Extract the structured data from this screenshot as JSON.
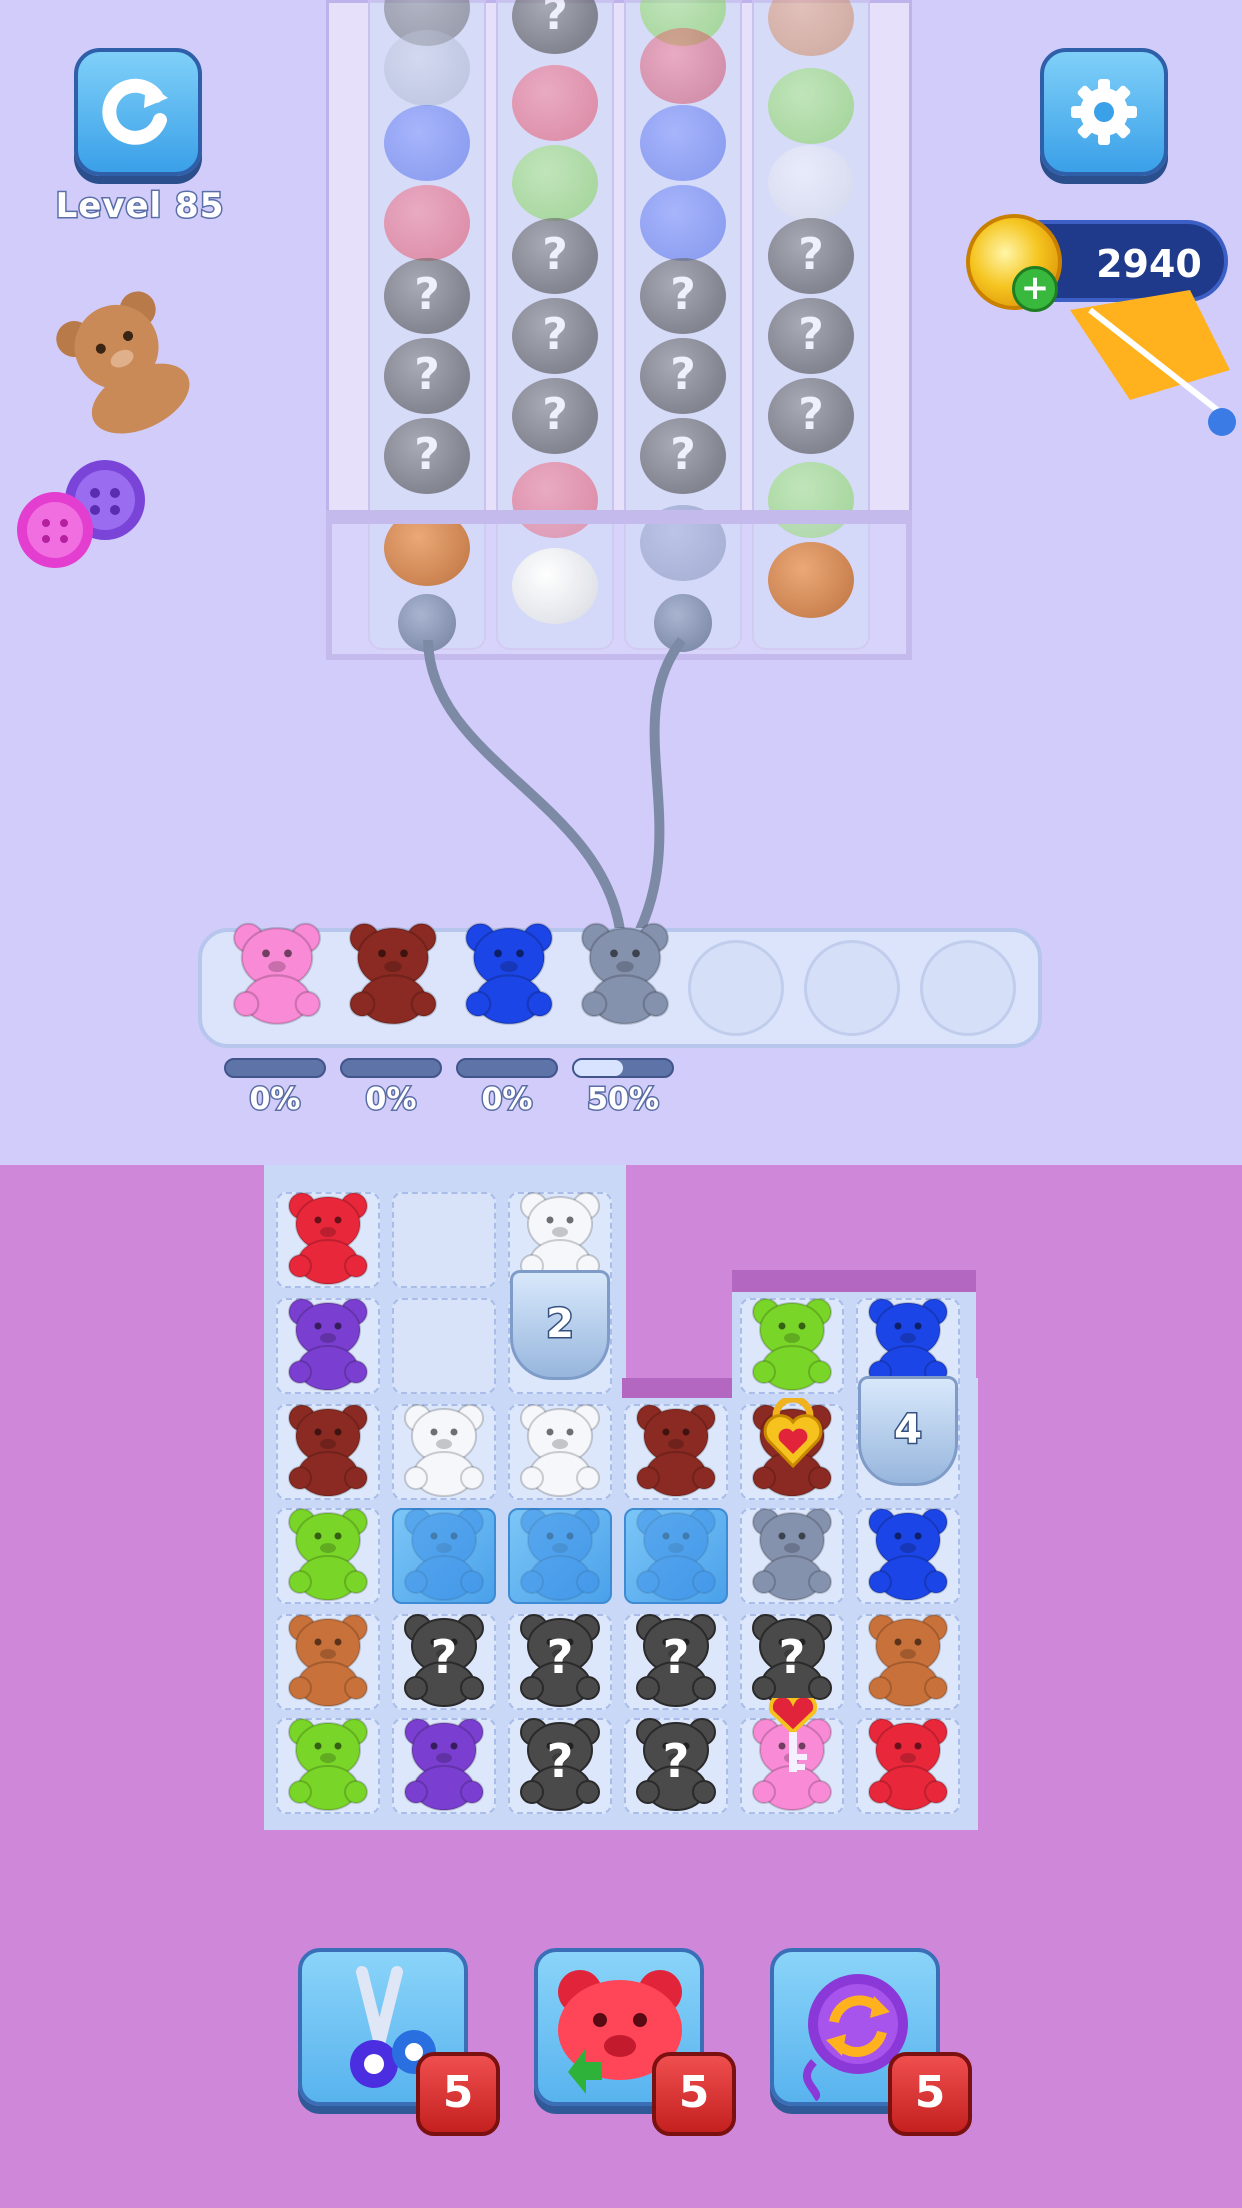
{
  "header": {
    "level_label": "Level 85",
    "coins": "2940",
    "restart_icon": "restart-icon",
    "settings_icon": "gear-icon"
  },
  "colors": {
    "pink": "#f98ad6",
    "maroon": "#8b2a22",
    "blue": "#1b45e6",
    "gray": "#8592ae",
    "red": "#e8273a",
    "purple": "#7a3fd0",
    "white": "#f5f7fb",
    "green": "#79d628",
    "brown": "#c9713a",
    "dark": "#4a4a4a",
    "orange": "#c8743a"
  },
  "tray": {
    "slots": [
      {
        "color": "pink",
        "percent": "0%",
        "progress": 0
      },
      {
        "color": "maroon",
        "percent": "0%",
        "progress": 0
      },
      {
        "color": "blue",
        "percent": "0%",
        "progress": 0
      },
      {
        "color": "gray",
        "percent": "50%",
        "progress": 0.5
      }
    ],
    "empty_slots": 3
  },
  "board": {
    "cup_a_label": "2",
    "cup_b_label": "4",
    "question_mark": "?"
  },
  "powerups": [
    {
      "name": "scissors-powerup",
      "count": "5"
    },
    {
      "name": "bear-powerup",
      "count": "5"
    },
    {
      "name": "yarn-swap-powerup",
      "count": "5"
    }
  ]
}
